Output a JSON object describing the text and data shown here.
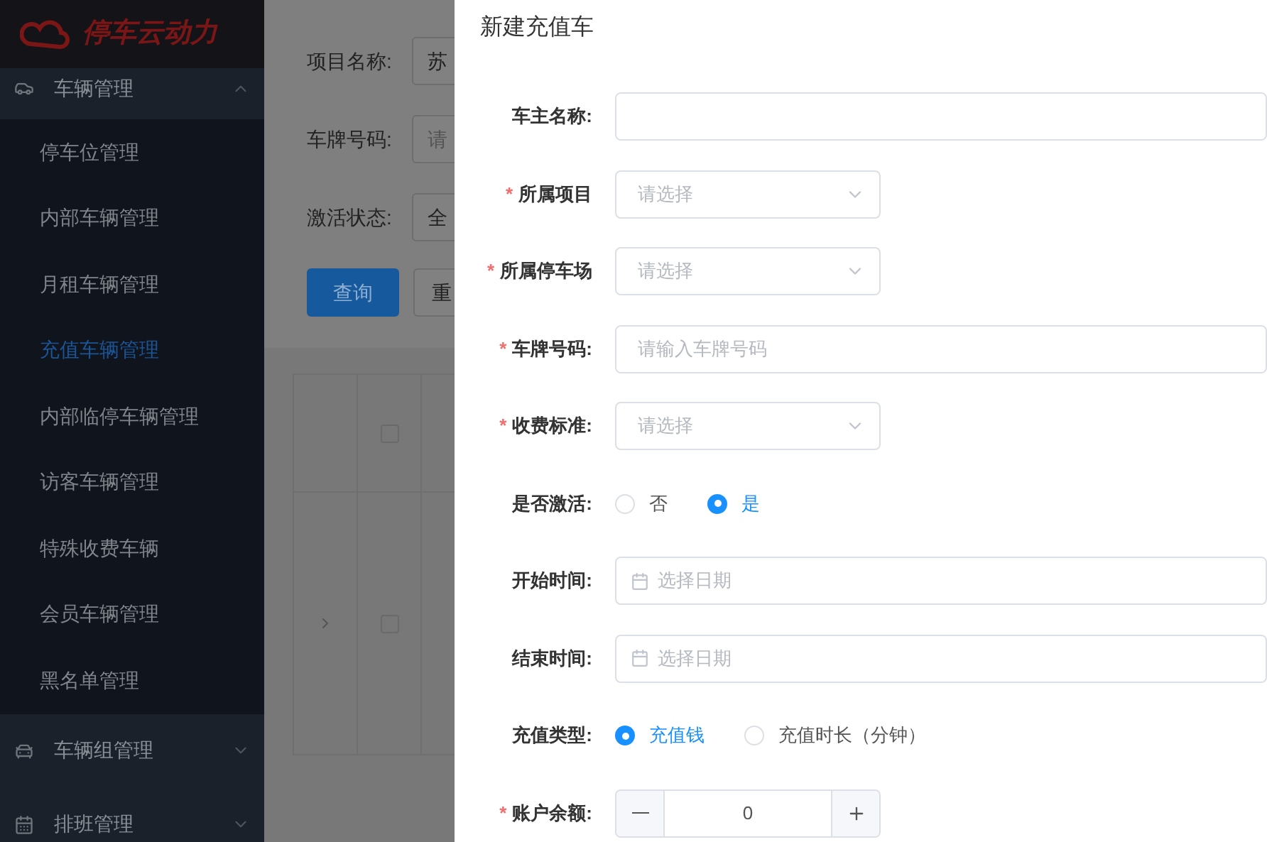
{
  "sidebar": {
    "logo": "停车云动力",
    "groups": [
      {
        "label": "车辆管理",
        "kind": "car",
        "expanded": true,
        "children": [
          {
            "label": "停车位管理",
            "selected": false
          },
          {
            "label": "内部车辆管理",
            "selected": false
          },
          {
            "label": "月租车辆管理",
            "selected": false
          },
          {
            "label": "充值车辆管理",
            "selected": true
          },
          {
            "label": "内部临停车辆管理",
            "selected": false
          },
          {
            "label": "访客车辆管理",
            "selected": false
          },
          {
            "label": "特殊收费车辆",
            "selected": false
          },
          {
            "label": "会员车辆管理",
            "selected": false
          },
          {
            "label": "黑名单管理",
            "selected": false
          }
        ]
      },
      {
        "label": "车辆组管理",
        "kind": "cars",
        "expanded": false
      },
      {
        "label": "排班管理",
        "kind": "calendar",
        "expanded": false
      }
    ]
  },
  "filters": [
    {
      "label": "项目名称:",
      "value": "苏"
    },
    {
      "label": "车牌号码:",
      "placeholder": "请"
    },
    {
      "label": "激活状态:",
      "value": "全"
    }
  ],
  "filter_buttons": [
    {
      "label": "查询",
      "kind": "primary"
    },
    {
      "label": "重",
      "kind": "default"
    }
  ],
  "table": {
    "rows": [
      {
        "checked": false,
        "expandable": false
      },
      {
        "checked": false,
        "expandable": true
      }
    ]
  },
  "drawer": {
    "title": "新建充值车",
    "required_mark": "*",
    "fields": [
      {
        "kind": "text",
        "label": "车主名称:",
        "required": false
      },
      {
        "kind": "select",
        "label": "所属项目",
        "required": true,
        "placeholder": "请选择"
      },
      {
        "kind": "select",
        "label": "所属停车场",
        "required": true,
        "placeholder": "请选择"
      },
      {
        "kind": "text",
        "label": "车牌号码:",
        "required": true,
        "placeholder": "请输入车牌号码"
      },
      {
        "kind": "select",
        "label": "收费标准:",
        "required": true,
        "placeholder": "请选择"
      },
      {
        "kind": "radio",
        "label": "是否激活:",
        "required": false,
        "options": [
          {
            "label": "否",
            "selected": false
          },
          {
            "label": "是",
            "selected": true
          }
        ]
      },
      {
        "kind": "date",
        "label": "开始时间:",
        "required": false,
        "placeholder": "选择日期"
      },
      {
        "kind": "date",
        "label": "结束时间:",
        "required": false,
        "placeholder": "选择日期"
      },
      {
        "kind": "radio",
        "label": "充值类型:",
        "required": false,
        "options": [
          {
            "label": "充值钱",
            "selected": true
          },
          {
            "label": "充值时长（分钟）",
            "selected": false
          }
        ]
      },
      {
        "kind": "number",
        "label": "账户余额:",
        "required": true,
        "value": "0"
      }
    ]
  }
}
